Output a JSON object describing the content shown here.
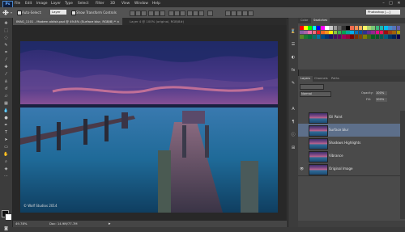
{
  "app": {
    "logo": "Ps",
    "menu": [
      "File",
      "Edit",
      "Image",
      "Layer",
      "Type",
      "Select",
      "Filter",
      "3D",
      "View",
      "Window",
      "Help"
    ],
    "window_controls": [
      "–",
      "□",
      "✕"
    ]
  },
  "options_bar": {
    "auto_select_label": "Auto-Select:",
    "auto_select_value": "Layer",
    "show_transform_label": "Show Transform Controls",
    "workspace": "Photoshop [...]"
  },
  "tabs": [
    {
      "label": "IMAG_1101 - Modern oldish.psd @ 49.8% (Surface blur, RGB/8) *",
      "active": true
    },
    {
      "label": "Layer 4 @ 100% (original, RGB/8#)",
      "active": false
    }
  ],
  "canvas": {
    "watermark": "© Wolf Studios 2014"
  },
  "status": {
    "zoom": "49.78%",
    "doc": "Doc: 14.9M/77.7M"
  },
  "swatches": {
    "tabs": [
      "Color",
      "Swatches"
    ]
  },
  "swatch_colors": [
    "#ff0000",
    "#ffff00",
    "#00ff00",
    "#00ffff",
    "#0000ff",
    "#ff00ff",
    "#ffffff",
    "#cccccc",
    "#999999",
    "#666666",
    "#333333",
    "#000000",
    "#f26c4f",
    "#f68e55",
    "#fbaf5c",
    "#fff467",
    "#acd372",
    "#7cc576",
    "#3bb878",
    "#1abbb4",
    "#00bff3",
    "#438ccb",
    "#5574b9",
    "#605ca8",
    "#855fa8",
    "#a763a8",
    "#f06eaa",
    "#f26d7d",
    "#ed1c24",
    "#f26522",
    "#f7941d",
    "#fff200",
    "#8dc63f",
    "#39b54a",
    "#00a651",
    "#00a99d",
    "#00aeef",
    "#0072bc",
    "#0054a6",
    "#2e3192",
    "#662d91",
    "#92278f",
    "#ec008c",
    "#ed145b",
    "#9e0b0f",
    "#a0410d",
    "#a36209",
    "#aba000",
    "#598527",
    "#1a7b30",
    "#007236",
    "#00746b",
    "#0076a3",
    "#004b80",
    "#003471",
    "#1b1464",
    "#440e62",
    "#630460",
    "#9e005d",
    "#9e0039",
    "#790000",
    "#7b2e00",
    "#7d4900",
    "#827b00",
    "#406618",
    "#005e20",
    "#005826",
    "#005952",
    "#005b7f",
    "#003663",
    "#002157",
    "#0d004c"
  ],
  "layers_panel": {
    "tabs": [
      "Layers",
      "Channels",
      "Paths"
    ],
    "blend_mode": "Normal",
    "opacity_label": "Opacity:",
    "opacity_value": "100%",
    "fill_label": "Fill:",
    "fill_value": "100%",
    "layers": [
      {
        "name": "Oil Paint",
        "selected": false,
        "visible": false
      },
      {
        "name": "Surface blur",
        "selected": true,
        "visible": false
      },
      {
        "name": "Shadows Highlights",
        "selected": false,
        "visible": false
      },
      {
        "name": "Vibrance",
        "selected": false,
        "visible": false
      },
      {
        "name": "Original Image",
        "selected": false,
        "visible": true
      }
    ]
  }
}
